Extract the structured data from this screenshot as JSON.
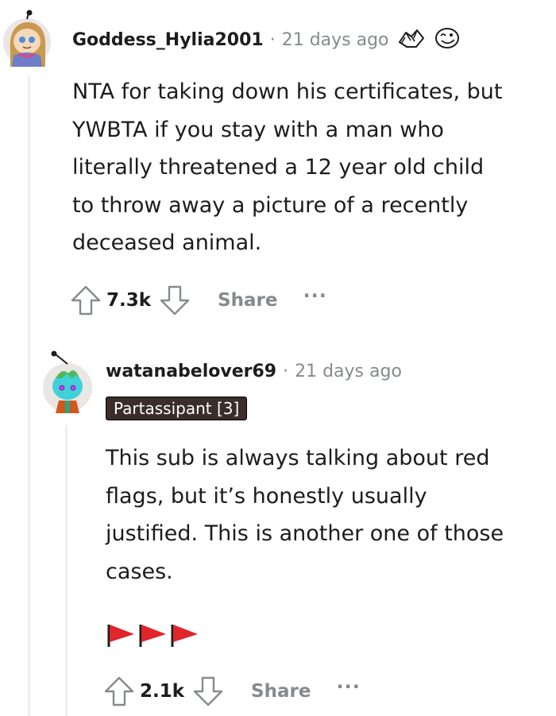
{
  "comments": [
    {
      "username": "Goddess_Hylia2001",
      "separator": "·",
      "time": "21 days ago",
      "awards": [
        "fist-bump-award-icon",
        "grin-award-icon"
      ],
      "body": [
        "NTA for taking down his certificates, but",
        "YWBTA if you stay with a man who",
        "literally threatened a 12 year old child",
        "to throw away a picture of a recently",
        "deceased animal."
      ],
      "score": "7.3k",
      "share_label": "Share",
      "more_label": "···"
    },
    {
      "username": "watanabelover69",
      "separator": "·",
      "time": "21 days ago",
      "flair": "Partassipant [3]",
      "body": [
        "This sub is always talking about red",
        "flags, but it’s honestly usually",
        "justified. This is another one of those",
        "cases."
      ],
      "emoji": "🚩🚩🚩",
      "score": "2.1k",
      "share_label": "Share",
      "more_label": "···"
    }
  ],
  "colors": {
    "muted": "#878a8c",
    "flair_bg": "#3a2d2a",
    "flag_red": "#e0252b"
  }
}
